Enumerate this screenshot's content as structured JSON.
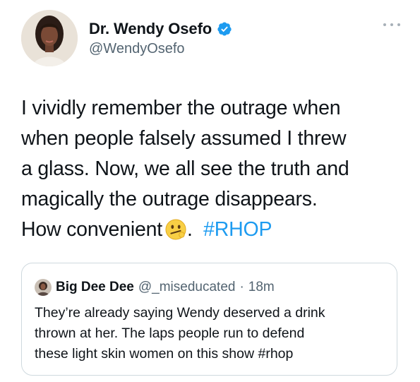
{
  "tweet": {
    "author": {
      "display_name": "Dr. Wendy Osefo",
      "handle": "@WendyOsefo",
      "verified": true,
      "avatar_icon": "profile-photo"
    },
    "text_lines": [
      "I vividly remember the outrage when",
      "when people falsely assumed I threw",
      "a glass. Now, we all see the truth and",
      "magically the outrage disappears.",
      "How convenient"
    ],
    "text_end_emoji": "face-with-diagonal-mouth-icon",
    "text_end_punct": ".",
    "hashtag": "#RHOP",
    "more_icon": "more-dots-icon"
  },
  "quoted_tweet": {
    "display_name": "Big Dee Dee",
    "handle": "@_miseducated",
    "separator": "·",
    "time": "18m",
    "text_lines": [
      "They’re already saying Wendy deserved a drink",
      "thrown at her. The laps people run to defend",
      "these light skin women on this show  #rhop"
    ]
  },
  "colors": {
    "accent": "#1d9bf0",
    "text": "#0f1419",
    "secondary": "#536471",
    "border": "#cfd9de"
  }
}
